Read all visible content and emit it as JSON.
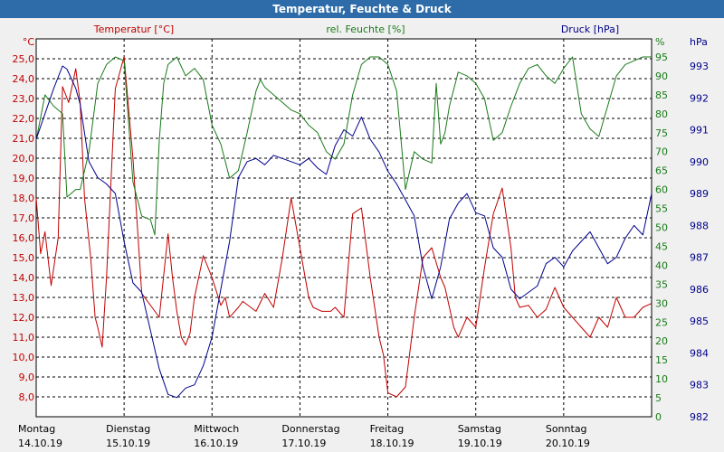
{
  "window": {
    "title": "Temperatur, Feuchte & Druck"
  },
  "colors": {
    "temperature": "#c00000",
    "humidity": "#1a7a1a",
    "pressure": "#00008b",
    "grid": "#000000",
    "background": "#ffffff"
  },
  "chart_data": {
    "type": "line",
    "title": "Temperatur, Feuchte & Druck",
    "grid": true,
    "x_range_days": [
      0,
      7
    ],
    "x_ticks": [
      {
        "day": "Montag",
        "date": "14.10.19"
      },
      {
        "day": "Dienstag",
        "date": "15.10.19"
      },
      {
        "day": "Mittwoch",
        "date": "16.10.19"
      },
      {
        "day": "Donnerstag",
        "date": "17.10.19"
      },
      {
        "day": "Freitag",
        "date": "18.10.19"
      },
      {
        "day": "Samstag",
        "date": "19.10.19"
      },
      {
        "day": "Sonntag",
        "date": "20.10.19"
      }
    ],
    "axes": {
      "temperature": {
        "label": "Temperatur [°C]",
        "unit": "°C",
        "side": "left",
        "range": [
          7.0,
          26.0
        ],
        "ticks": [
          "8,0",
          "9,0",
          "10,0",
          "11,0",
          "12,0",
          "13,0",
          "14,0",
          "15,0",
          "16,0",
          "17,0",
          "18,0",
          "19,0",
          "20,0",
          "21,0",
          "22,0",
          "23,0",
          "24,0",
          "25,0"
        ],
        "tick_values": [
          8,
          9,
          10,
          11,
          12,
          13,
          14,
          15,
          16,
          17,
          18,
          19,
          20,
          21,
          22,
          23,
          24,
          25
        ]
      },
      "humidity": {
        "label": "rel. Feuchte [%]",
        "unit": "%",
        "side": "right-inner",
        "range": [
          0,
          95
        ],
        "ticks": [
          "0",
          "5",
          "10",
          "15",
          "20",
          "25",
          "30",
          "35",
          "40",
          "45",
          "50",
          "55",
          "60",
          "65",
          "70",
          "75",
          "80",
          "85",
          "90",
          "95"
        ],
        "tick_values": [
          0,
          5,
          10,
          15,
          20,
          25,
          30,
          35,
          40,
          45,
          50,
          55,
          60,
          65,
          70,
          75,
          80,
          85,
          90,
          95
        ]
      },
      "pressure": {
        "label": "Druck [hPa]",
        "unit": "hPa",
        "side": "right-outer",
        "range": [
          982,
          993
        ],
        "ticks": [
          "982",
          "983",
          "984",
          "985",
          "986",
          "987",
          "988",
          "989",
          "990",
          "991",
          "992",
          "993"
        ],
        "tick_values": [
          982,
          983,
          984,
          985,
          986,
          987,
          988,
          989,
          990,
          991,
          992,
          993
        ]
      }
    },
    "series": [
      {
        "name": "Temperatur [°C]",
        "axis": "temperature",
        "color": "#c00000",
        "x": [
          0,
          0.05,
          0.1,
          0.17,
          0.25,
          0.3,
          0.37,
          0.45,
          0.5,
          0.55,
          0.62,
          0.67,
          0.7,
          0.75,
          0.8,
          0.9,
          1.0,
          1.1,
          1.2,
          1.4,
          1.5,
          1.55,
          1.6,
          1.65,
          1.7,
          1.75,
          1.8,
          1.9,
          2.0,
          2.1,
          2.15,
          2.2,
          2.3,
          2.35,
          2.5,
          2.6,
          2.7,
          2.8,
          2.9,
          3.0,
          3.1,
          3.15,
          3.25,
          3.35,
          3.4,
          3.5,
          3.6,
          3.7,
          3.8,
          3.9,
          3.95,
          4.0,
          4.1,
          4.2,
          4.3,
          4.4,
          4.5,
          4.6,
          4.65,
          4.7,
          4.75,
          4.8,
          4.9,
          5.0,
          5.1,
          5.2,
          5.3,
          5.4,
          5.45,
          5.5,
          5.6,
          5.7,
          5.8,
          5.9,
          6.0,
          6.1,
          6.2,
          6.3,
          6.4,
          6.5,
          6.6,
          6.7,
          6.8,
          6.9,
          7.0
        ],
        "y": [
          18.0,
          15.2,
          16.3,
          13.6,
          16.0,
          23.6,
          22.8,
          24.5,
          22.8,
          18.0,
          15.0,
          12.0,
          11.5,
          10.5,
          14.0,
          23.5,
          25.1,
          20.0,
          13.2,
          12.0,
          16.2,
          14.0,
          12.3,
          11.0,
          10.6,
          11.2,
          13.0,
          15.1,
          14.0,
          12.6,
          13.0,
          12.0,
          12.5,
          12.8,
          12.3,
          13.2,
          12.5,
          15.0,
          18.0,
          15.5,
          13.0,
          12.5,
          12.3,
          12.3,
          12.5,
          12.0,
          17.2,
          17.5,
          14.0,
          11.0,
          10.1,
          8.2,
          8.0,
          8.5,
          12.0,
          15.0,
          15.5,
          14.0,
          13.5,
          12.5,
          11.5,
          11.0,
          12.0,
          11.5,
          14.5,
          17.2,
          18.5,
          15.5,
          13.0,
          12.5,
          12.6,
          12.0,
          12.4,
          13.5,
          12.5,
          12.0,
          11.5,
          11.0,
          12.0,
          11.5,
          13.0,
          12.0,
          12.0,
          12.5,
          12.7
        ]
      },
      {
        "name": "rel. Feuchte [%]",
        "axis": "humidity",
        "color": "#1a7a1a",
        "x": [
          0,
          0.1,
          0.2,
          0.3,
          0.35,
          0.45,
          0.5,
          0.6,
          0.7,
          0.8,
          0.9,
          1.0,
          1.1,
          1.2,
          1.3,
          1.35,
          1.4,
          1.45,
          1.5,
          1.6,
          1.7,
          1.8,
          1.9,
          2.0,
          2.1,
          2.2,
          2.3,
          2.4,
          2.5,
          2.55,
          2.6,
          2.7,
          2.8,
          2.9,
          3.0,
          3.1,
          3.2,
          3.3,
          3.4,
          3.5,
          3.6,
          3.7,
          3.8,
          3.9,
          4.0,
          4.1,
          4.2,
          4.3,
          4.4,
          4.5,
          4.55,
          4.6,
          4.65,
          4.7,
          4.8,
          4.9,
          5.0,
          5.1,
          5.2,
          5.3,
          5.4,
          5.5,
          5.6,
          5.7,
          5.8,
          5.9,
          6.0,
          6.1,
          6.2,
          6.3,
          6.4,
          6.5,
          6.6,
          6.7,
          6.8,
          6.9,
          7.0
        ],
        "y": [
          73,
          85,
          82,
          80,
          58,
          60,
          60,
          70,
          88,
          93,
          95,
          94,
          62,
          53,
          52,
          48,
          73,
          88,
          93,
          95,
          90,
          92,
          89,
          77,
          72,
          63,
          65,
          75,
          86,
          89,
          87,
          85,
          83,
          81,
          80,
          77,
          75,
          70,
          68,
          72,
          85,
          93,
          95,
          95,
          93,
          86,
          60,
          70,
          68,
          67,
          88,
          72,
          75,
          82,
          91,
          90,
          88,
          84,
          73,
          75,
          82,
          88,
          92,
          93,
          90,
          88,
          92,
          95,
          80,
          76,
          74,
          82,
          90,
          93,
          94,
          95,
          95
        ]
      },
      {
        "name": "Druck [hPa]",
        "axis": "pressure",
        "color": "#00008b",
        "x": [
          0,
          0.1,
          0.2,
          0.3,
          0.35,
          0.45,
          0.5,
          0.55,
          0.6,
          0.7,
          0.8,
          0.9,
          1.0,
          1.1,
          1.2,
          1.3,
          1.4,
          1.5,
          1.6,
          1.7,
          1.8,
          1.9,
          2.0,
          2.1,
          2.2,
          2.3,
          2.4,
          2.5,
          2.6,
          2.7,
          2.8,
          2.9,
          3.0,
          3.1,
          3.2,
          3.3,
          3.4,
          3.5,
          3.6,
          3.7,
          3.8,
          3.9,
          4.0,
          4.1,
          4.2,
          4.3,
          4.4,
          4.5,
          4.6,
          4.7,
          4.8,
          4.9,
          5.0,
          5.1,
          5.2,
          5.3,
          5.4,
          5.5,
          5.6,
          5.7,
          5.8,
          5.9,
          6.0,
          6.1,
          6.2,
          6.3,
          6.4,
          6.5,
          6.6,
          6.7,
          6.8,
          6.9,
          7.0
        ],
        "y": [
          990.7,
          991.5,
          992.3,
          993.0,
          992.9,
          992.3,
          991.8,
          990.9,
          990.0,
          989.5,
          989.3,
          989.0,
          987.5,
          986.2,
          985.9,
          984.7,
          983.5,
          982.7,
          982.6,
          982.9,
          983.0,
          983.6,
          984.5,
          986.0,
          987.5,
          989.5,
          990.0,
          990.1,
          989.9,
          990.2,
          990.1,
          990.0,
          989.9,
          990.1,
          989.8,
          989.6,
          990.5,
          991.0,
          990.8,
          991.4,
          990.7,
          990.3,
          989.7,
          989.3,
          988.8,
          988.3,
          986.7,
          985.7,
          986.7,
          988.2,
          988.7,
          989.0,
          988.4,
          988.3,
          987.3,
          987.0,
          986.0,
          985.7,
          985.9,
          986.1,
          986.8,
          987.0,
          986.7,
          987.2,
          987.5,
          987.8,
          987.3,
          986.8,
          987.0,
          987.6,
          988.0,
          987.7,
          989.0
        ]
      }
    ]
  }
}
